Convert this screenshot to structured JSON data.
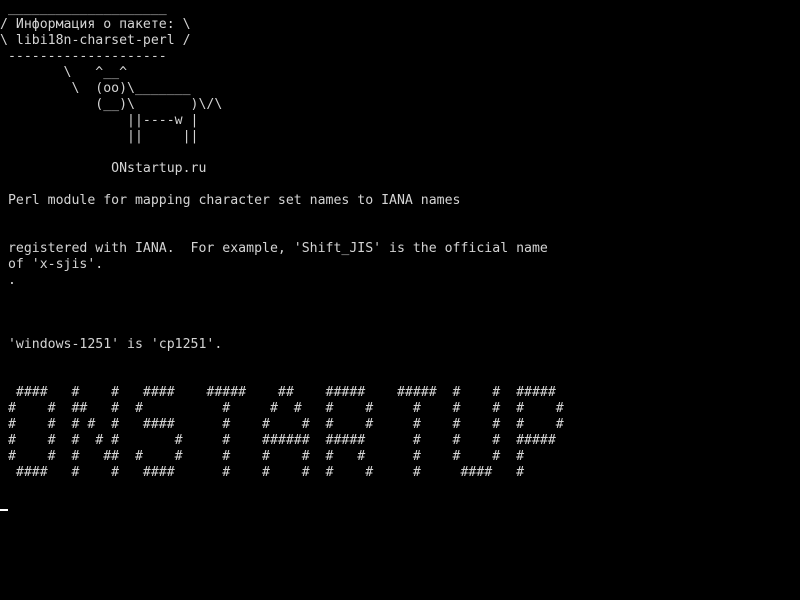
{
  "terminal": {
    "cowsay": {
      "top_border": " ____________________",
      "title_line": "/ Информация о пакете: \\",
      "package_line": "\\ libi18n-charset-perl /",
      "bottom_border": " --------------------",
      "cow_1": "        \\   ^__^",
      "cow_2": "         \\  (oo)\\_______",
      "cow_3": "            (__)\\       )\\/\\",
      "cow_4": "                ||----w |",
      "cow_5": "                ||     ||"
    },
    "site": "              ONstartup.ru",
    "summary": " Perl module for mapping character set names to IANA names",
    "desc_1": " registered with IANA.  For example, 'Shift_JIS' is the official name",
    "desc_2": " of 'x-sjis'.",
    "desc_3": " .",
    "desc_4": " 'windows-1251' is 'cp1251'.",
    "banner": [
      "  ####   #    #   ####    #####    ##    #####    #####  #    #  #####",
      " #    #  ##   #  #          #     #  #   #    #     #    #    #  #    #",
      " #    #  # #  #   ####      #    #    #  #    #     #    #    #  #    #",
      " #    #  #  # #       #     #    ######  #####      #    #    #  #####",
      " #    #  #   ##  #    #     #    #    #  #   #      #    #    #  #",
      "  ####   #    #   ####      #    #    #  #    #     #     ####   #"
    ]
  }
}
